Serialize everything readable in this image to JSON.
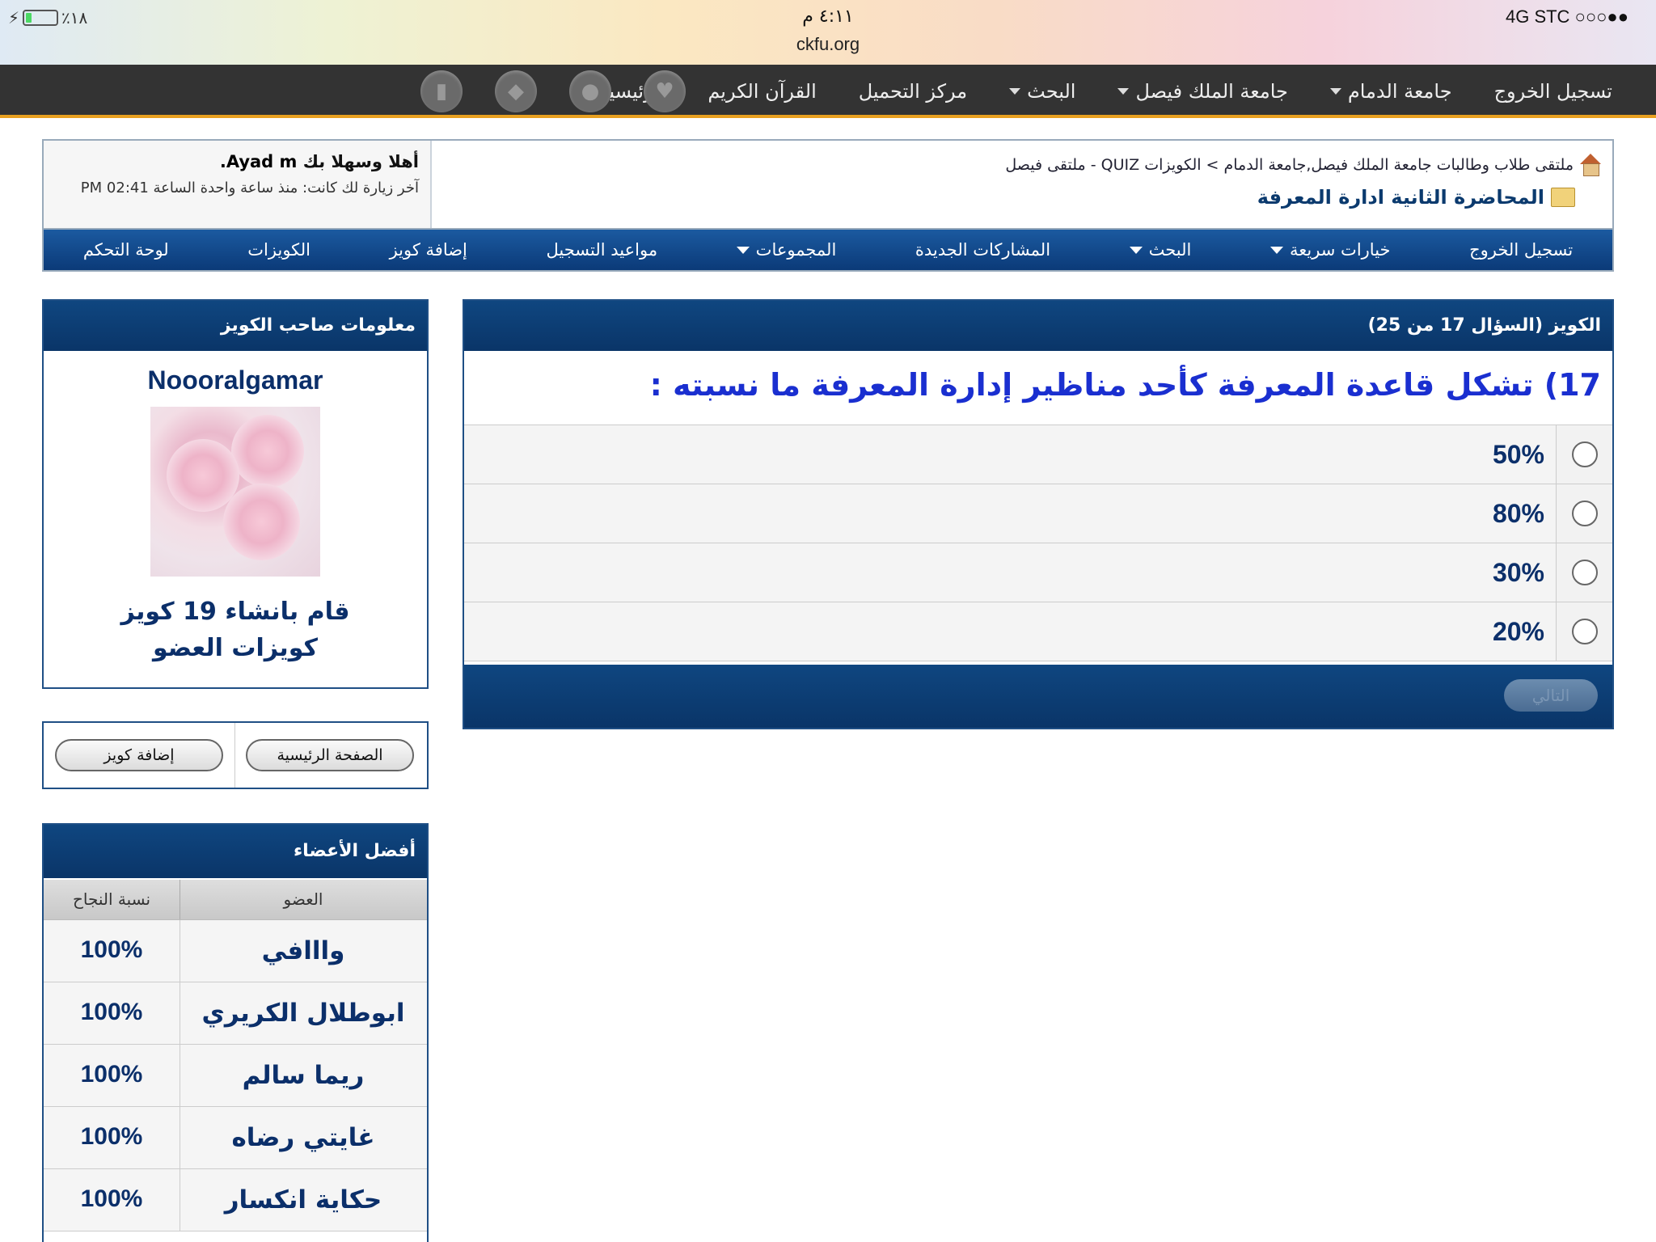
{
  "status_bar": {
    "carrier": "4G  STC ○○○●●",
    "time": "٤:١١ م",
    "url": "ckfu.org",
    "battery_text": "٪١٨",
    "battery_level": 0.18
  },
  "top_nav": {
    "items": [
      "الرئيسية",
      "القرآن الكريم",
      "مركز التحميل",
      "البحث",
      "جامعة الملك فيصل",
      "جامعة الدمام",
      "تسجيل الخروج"
    ],
    "dropdown_flags": [
      false,
      false,
      false,
      true,
      true,
      true,
      false
    ],
    "icons": [
      "stats-icon",
      "diamond-icon",
      "profile-icon",
      "heart-icon"
    ]
  },
  "header": {
    "breadcrumb": "ملتقى طلاب وطالبات جامعة الملك فيصل,جامعة الدمام > الكويزات QUIZ - ملتقى فيصل",
    "page_title": "المحاضرة الثانية ادارة المعرفة",
    "welcome_prefix": "أهلا وسهلا بك",
    "username": "Ayad m.",
    "last_visit": "آخر زيارة لك كانت: منذ ساعة واحدة الساعة 02:41 PM"
  },
  "blue_nav": {
    "items": [
      "لوحة التحكم",
      "الكويزات",
      "إضافة كويز",
      "مواعيد التسجيل",
      "المجموعات",
      "المشاركات الجديدة",
      "البحث",
      "خيارات سريعة",
      "تسجيل الخروج"
    ],
    "dropdown_flags": [
      false,
      false,
      false,
      false,
      true,
      false,
      true,
      true,
      false
    ]
  },
  "quiz": {
    "header": "الكويز (السؤال 17 من 25)",
    "question": "17) تشكل قاعدة المعرفة كأحد مناظير إدارة المعرفة ما نسبته :",
    "answers": [
      "50%",
      "80%",
      "30%",
      "20%"
    ],
    "next_label": "التالي"
  },
  "owner": {
    "header": "معلومات صاحب الكويز",
    "name": "Noooralgamar",
    "quiz_count": "قام بانشاء 19 كويز",
    "member_quizzes_link": "كويزات العضو"
  },
  "buttons": {
    "home": "الصفحة الرئيسية",
    "add_quiz": "إضافة كويز"
  },
  "top_members": {
    "header": "أفضل الأعضاء",
    "col_member": "العضو",
    "col_rate": "نسبة النجاح",
    "rows": [
      {
        "name": "وااافي",
        "rate": "100%"
      },
      {
        "name": "ابوطلال الكريري",
        "rate": "100%"
      },
      {
        "name": "ريما سالم",
        "rate": "100%"
      },
      {
        "name": "غايتي رضاه",
        "rate": "100%"
      },
      {
        "name": "حكاية انكسار",
        "rate": "100%"
      }
    ]
  }
}
